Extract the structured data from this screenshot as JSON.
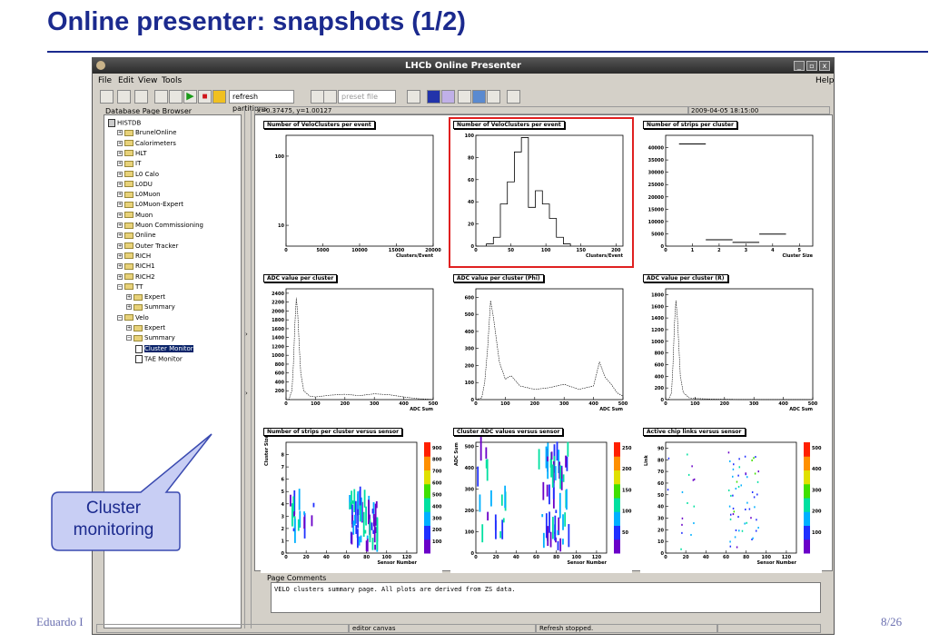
{
  "slide": {
    "title": "Online presenter: snapshots (1/2)",
    "footer_left": "Eduardo I",
    "page": "8/26"
  },
  "window": {
    "title": "LHCb Online Presenter",
    "btn_min": "_",
    "btn_max": "▫",
    "btn_close": "x"
  },
  "menu": {
    "file": "File",
    "edit": "Edit",
    "view": "View",
    "tools": "Tools",
    "help": "Help"
  },
  "toolbar": {
    "refresh_label": "refresh partitions",
    "preset_placeholder": "preset file"
  },
  "browser": {
    "label": "Database Page Browser",
    "items": [
      {
        "label": "HISTDB",
        "level": 0,
        "icon": "root"
      },
      {
        "label": "BrunelOnline",
        "level": 1,
        "icon": "folder",
        "pm": "+"
      },
      {
        "label": "Calorimeters",
        "level": 1,
        "icon": "folder",
        "pm": "+"
      },
      {
        "label": "HLT",
        "level": 1,
        "icon": "folder",
        "pm": "+"
      },
      {
        "label": "IT",
        "level": 1,
        "icon": "folder",
        "pm": "+"
      },
      {
        "label": "L0 Calo",
        "level": 1,
        "icon": "folder",
        "pm": "+"
      },
      {
        "label": "L0DU",
        "level": 1,
        "icon": "folder",
        "pm": "+"
      },
      {
        "label": "L0Muon",
        "level": 1,
        "icon": "folder",
        "pm": "+"
      },
      {
        "label": "L0Muon-Expert",
        "level": 1,
        "icon": "folder",
        "pm": "+"
      },
      {
        "label": "Muon",
        "level": 1,
        "icon": "folder",
        "pm": "+"
      },
      {
        "label": "Muon Commissioning",
        "level": 1,
        "icon": "folder",
        "pm": "+"
      },
      {
        "label": "Online",
        "level": 1,
        "icon": "folder",
        "pm": "+"
      },
      {
        "label": "Outer Tracker",
        "level": 1,
        "icon": "folder",
        "pm": "+"
      },
      {
        "label": "RICH",
        "level": 1,
        "icon": "folder",
        "pm": "+"
      },
      {
        "label": "RICH1",
        "level": 1,
        "icon": "folder",
        "pm": "+"
      },
      {
        "label": "RICH2",
        "level": 1,
        "icon": "folder",
        "pm": "+"
      },
      {
        "label": "TT",
        "level": 1,
        "icon": "folder",
        "pm": "−"
      },
      {
        "label": "Expert",
        "level": 2,
        "icon": "folder",
        "pm": "+"
      },
      {
        "label": "Summary",
        "level": 2,
        "icon": "folder",
        "pm": "+"
      },
      {
        "label": "Velo",
        "level": 1,
        "icon": "folder",
        "pm": "−"
      },
      {
        "label": "Expert",
        "level": 2,
        "icon": "folder",
        "pm": "+"
      },
      {
        "label": "Summary",
        "level": 2,
        "icon": "folder",
        "pm": "−"
      },
      {
        "label": "Cluster Monitor",
        "level": 3,
        "icon": "page",
        "selected": true
      },
      {
        "label": "TAE Monitor",
        "level": 3,
        "icon": "page"
      }
    ]
  },
  "status": {
    "coords": "x=0.37475, y=1.00127",
    "date": "2009-04-05 18:15:00"
  },
  "comments": {
    "label": "Page Comments",
    "text": "VELO clusters summary page.  All plots are derived from ZS data."
  },
  "statusbar": {
    "canvas": "editor canvas",
    "refresh": "Refresh stopped."
  },
  "callout": {
    "line1": "Cluster",
    "line2": "monitoring"
  },
  "chart_data": [
    {
      "type": "step",
      "title": "Number of VeloClusters per event",
      "xlabel": "Clusters/Event",
      "ylabel": "",
      "log_y": true,
      "xlim": [
        0,
        20000
      ],
      "yticks": [
        10,
        100
      ],
      "xticks": [
        0,
        5000,
        10000,
        15000,
        20000
      ],
      "x": [],
      "y": []
    },
    {
      "type": "step",
      "title": "Number of VeloClusters per event",
      "xlabel": "Clusters/Event",
      "ylabel": "",
      "xlim": [
        0,
        210
      ],
      "ylim": [
        0,
        100
      ],
      "xticks": [
        0,
        50,
        100,
        150,
        200
      ],
      "yticks": [
        0,
        20,
        40,
        60,
        80,
        100
      ],
      "x": [
        20,
        30,
        40,
        50,
        60,
        70,
        80,
        90,
        100,
        110,
        120,
        130
      ],
      "y": [
        2,
        8,
        38,
        58,
        85,
        98,
        35,
        50,
        38,
        25,
        8,
        2
      ]
    },
    {
      "type": "step",
      "title": "Number of strips per cluster",
      "xlabel": "Cluster Size",
      "ylabel": "",
      "xlim": [
        0,
        5.5
      ],
      "ylim": [
        0,
        45000
      ],
      "xticks": [
        0,
        1,
        2,
        3,
        4,
        5
      ],
      "yticks": [
        0,
        5000,
        10000,
        15000,
        20000,
        25000,
        30000,
        35000,
        40000
      ],
      "x": [
        1,
        2,
        3,
        4
      ],
      "y": [
        41500,
        2600,
        1500,
        4900
      ]
    },
    {
      "type": "line",
      "title": "ADC value per cluster",
      "xlabel": "ADC Sum",
      "ylabel": "",
      "xlim": [
        0,
        500
      ],
      "ylim": [
        0,
        2500
      ],
      "xticks": [
        0,
        100,
        200,
        300,
        400,
        500
      ],
      "yticks": [
        200,
        400,
        600,
        800,
        1000,
        1200,
        1400,
        1600,
        1800,
        2000,
        2200,
        2400
      ],
      "x": [
        0,
        10,
        20,
        25,
        30,
        35,
        40,
        45,
        50,
        60,
        80,
        100,
        150,
        200,
        250,
        300,
        350,
        400,
        450,
        500
      ],
      "y": [
        0,
        10,
        200,
        800,
        1700,
        2300,
        1900,
        1200,
        600,
        200,
        80,
        60,
        100,
        120,
        90,
        130,
        110,
        60,
        20,
        5
      ]
    },
    {
      "type": "line",
      "title": "ADC value per cluster (Phi)",
      "xlabel": "ADC Sum",
      "ylabel": "",
      "xlim": [
        0,
        500
      ],
      "ylim": [
        0,
        650
      ],
      "xticks": [
        0,
        100,
        200,
        300,
        400,
        500
      ],
      "yticks": [
        0,
        100,
        200,
        300,
        400,
        500,
        600
      ],
      "x": [
        0,
        20,
        30,
        40,
        50,
        60,
        70,
        80,
        100,
        120,
        150,
        200,
        250,
        300,
        350,
        400,
        420,
        440,
        460,
        480,
        500
      ],
      "y": [
        0,
        10,
        100,
        300,
        580,
        480,
        350,
        220,
        120,
        140,
        80,
        60,
        70,
        90,
        60,
        80,
        220,
        130,
        90,
        40,
        20
      ]
    },
    {
      "type": "line",
      "title": "ADC value per cluster (R)",
      "xlabel": "ADC Sum",
      "ylabel": "",
      "xlim": [
        0,
        500
      ],
      "ylim": [
        0,
        1900
      ],
      "xticks": [
        0,
        100,
        200,
        300,
        400,
        500
      ],
      "yticks": [
        0,
        200,
        400,
        600,
        800,
        1000,
        1200,
        1400,
        1600,
        1800
      ],
      "x": [
        0,
        10,
        20,
        25,
        30,
        35,
        40,
        45,
        50,
        60,
        80,
        100,
        150,
        200,
        300,
        500
      ],
      "y": [
        0,
        5,
        120,
        600,
        1300,
        1700,
        1400,
        900,
        400,
        120,
        30,
        20,
        10,
        5,
        2,
        0
      ]
    },
    {
      "type": "heatmap",
      "title": "Number of strips per cluster versus sensor",
      "xlabel": "Sensor Number",
      "ylabel": "Cluster Size",
      "xlim": [
        0,
        130
      ],
      "ylim": [
        0,
        9
      ],
      "xticks": [
        0,
        20,
        40,
        60,
        80,
        100,
        120
      ],
      "yticks": [
        0,
        1,
        2,
        3,
        4,
        5,
        6,
        7,
        8
      ],
      "zticks": [
        100,
        200,
        300,
        400,
        500,
        600,
        700,
        800,
        900
      ]
    },
    {
      "type": "heatmap",
      "title": "Cluster ADC values versus sensor",
      "xlabel": "Sensor Number",
      "ylabel": "ADC Sum",
      "xlim": [
        0,
        130
      ],
      "ylim": [
        0,
        520
      ],
      "xticks": [
        0,
        20,
        40,
        60,
        80,
        100,
        120
      ],
      "yticks": [
        0,
        100,
        200,
        300,
        400,
        500
      ],
      "zticks": [
        50,
        100,
        150,
        200,
        250
      ]
    },
    {
      "type": "heatmap",
      "title": "Active chip links versus sensor",
      "xlabel": "Sensor Number",
      "ylabel": "Link",
      "xlim": [
        0,
        130
      ],
      "ylim": [
        0,
        95
      ],
      "xticks": [
        0,
        20,
        40,
        60,
        80,
        100,
        120
      ],
      "yticks": [
        0,
        10,
        20,
        30,
        40,
        50,
        60,
        70,
        80,
        90
      ],
      "zticks": [
        100,
        200,
        300,
        400,
        500
      ]
    }
  ]
}
